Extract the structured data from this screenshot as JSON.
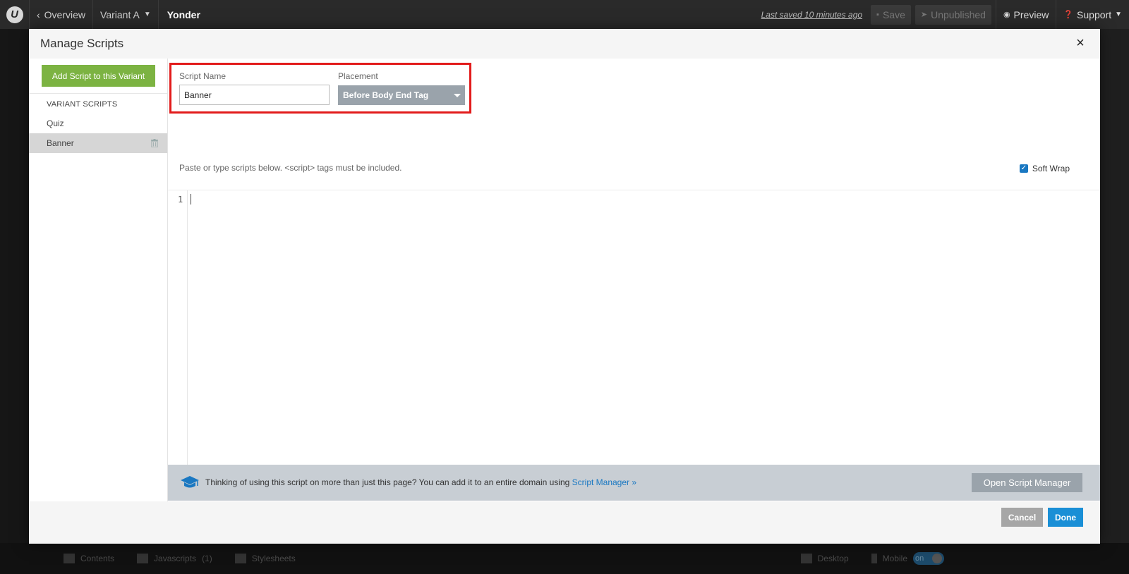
{
  "topbar": {
    "back_label": "Overview",
    "variant_label": "Variant A",
    "page_title": "Yonder",
    "last_saved": "Last saved  10 minutes ago",
    "save_label": "Save",
    "unpublished_label": "Unpublished",
    "preview_label": "Preview",
    "support_label": "Support"
  },
  "background": {
    "contents_label": "Contents",
    "javascripts_label": "Javascripts",
    "javascripts_count": "(1)",
    "stylesheets_label": "Stylesheets",
    "desktop_label": "Desktop",
    "mobile_label": "Mobile",
    "toggle_label": "on"
  },
  "modal": {
    "title": "Manage Scripts",
    "close_symbol": "×",
    "add_script_label": "Add Script to this Variant",
    "variant_scripts_heading": "VARIANT SCRIPTS",
    "scripts": [
      {
        "name": "Quiz",
        "active": false
      },
      {
        "name": "Banner",
        "active": true
      }
    ],
    "script_name_label": "Script Name",
    "script_name_value": "Banner",
    "placement_label": "Placement",
    "placement_value": "Before Body End Tag",
    "instructions": "Paste or type scripts below. <script> tags must be included.",
    "soft_wrap_label": "Soft Wrap",
    "soft_wrap_checked": true,
    "editor_line_number": "1",
    "footer_text": "Thinking of using this script on more than just this page? You can add it to an entire domain using ",
    "footer_link": "Script Manager »",
    "open_script_manager_label": "Open Script Manager",
    "cancel_label": "Cancel",
    "done_label": "Done"
  },
  "colors": {
    "accent_green": "#7cb342",
    "accent_blue": "#1a8fd6",
    "highlight_red": "#e21b1b"
  }
}
